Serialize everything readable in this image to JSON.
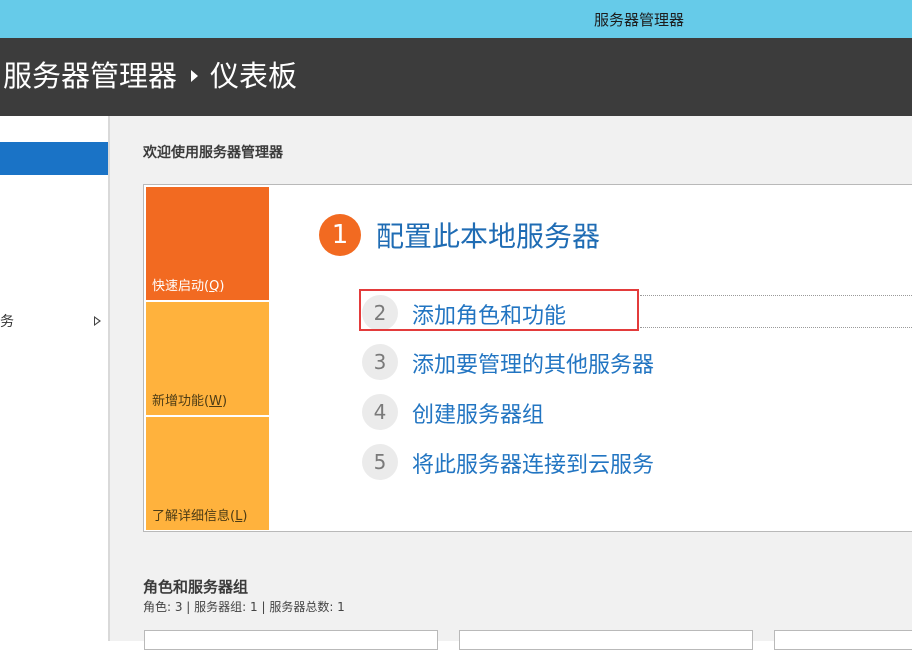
{
  "window": {
    "title": "服务器管理器"
  },
  "header": {
    "app": "服务器管理器",
    "page": "仪表板"
  },
  "sidebar": {
    "items": [
      {
        "label": "",
        "selected": true
      },
      {
        "label": "务",
        "has_submenu": true
      }
    ]
  },
  "main": {
    "welcome_heading": "欢迎使用服务器管理器",
    "tiles": [
      {
        "label": "快速启动",
        "accel": "Q"
      },
      {
        "label": "新增功能",
        "accel": "W"
      },
      {
        "label": "了解详细信息",
        "accel": "L"
      }
    ],
    "steps": [
      {
        "number": "1",
        "label": "配置此本地服务器"
      },
      {
        "number": "2",
        "label": "添加角色和功能"
      },
      {
        "number": "3",
        "label": "添加要管理的其他服务器"
      },
      {
        "number": "4",
        "label": "创建服务器组"
      },
      {
        "number": "5",
        "label": "将此服务器连接到云服务"
      }
    ],
    "roles": {
      "title": "角色和服务器组",
      "summary": "角色: 3 | 服务器组: 1 | 服务器总数: 1"
    }
  },
  "colors": {
    "titlebar": "#66cbe9",
    "header": "#3c3c3c",
    "accent_orange": "#f26a21",
    "tile_yellow": "#ffb23d",
    "link_blue": "#1f6cb4",
    "selection_blue": "#1a73c6",
    "highlight_red": "#e33b3b"
  }
}
